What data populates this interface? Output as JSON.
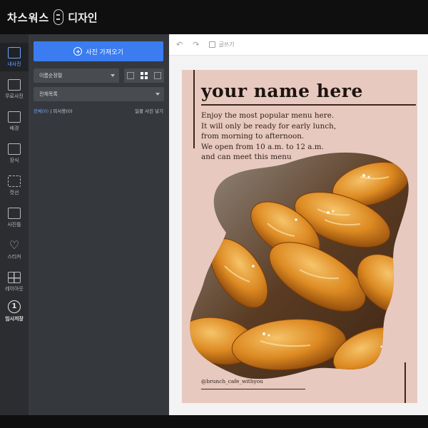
{
  "app": {
    "brand_name": "차스워스",
    "brand_sub": "디자인"
  },
  "rail": {
    "items": [
      {
        "label": "내사진",
        "icon": "camera-icon",
        "active": true
      },
      {
        "label": "무료사진",
        "icon": "image-library-icon",
        "active": false
      },
      {
        "label": "배경",
        "icon": "background-icon",
        "active": false
      },
      {
        "label": "장식",
        "icon": "decoration-icon",
        "active": false
      },
      {
        "label": "컷선",
        "icon": "scissors-icon",
        "active": false
      },
      {
        "label": "사진틀",
        "icon": "frame-icon",
        "active": false
      },
      {
        "label": "스티커",
        "icon": "heart-sticker-icon",
        "active": false
      },
      {
        "label": "레이아웃",
        "icon": "layout-icon",
        "active": false
      },
      {
        "label": "임시저장",
        "icon": "save-number-icon",
        "active": false
      }
    ],
    "save_badge": "1"
  },
  "panel": {
    "import_button": "사진 가져오기",
    "sort_select": "이름순정렬",
    "folder_select": "전체목록",
    "link_left_blue": "전체(0)",
    "link_left_rest": "| 미사용(0)",
    "link_right": "일괄 사진 넣기"
  },
  "toolbar": {
    "undo_icon": "undo-icon",
    "redo_icon": "redo-icon",
    "text_label": "글쓰기"
  },
  "poster": {
    "title": "your name here",
    "body_lines": [
      "Enjoy the most popular menu here.",
      "It will only be ready for early lunch,",
      "from morning to afternoon.",
      "We open from 10 a.m. to 12 a.m.",
      "and can meet this menu"
    ],
    "handle": "@brunch_cafe_withyou",
    "bg_color": "#e8c9bf"
  },
  "colors": {
    "accent": "#3b7cf0",
    "rail_active": "#6ea4ff"
  }
}
